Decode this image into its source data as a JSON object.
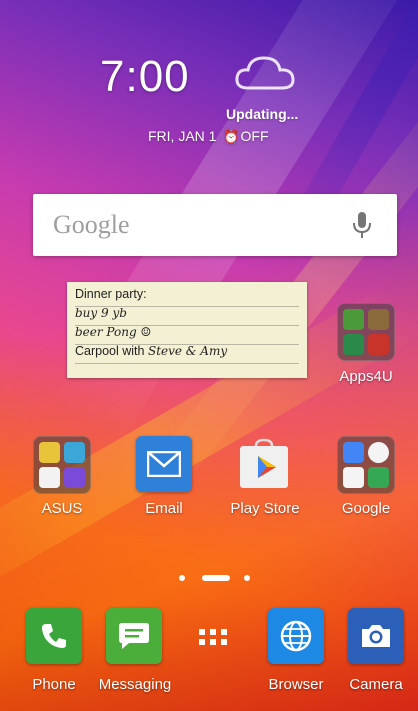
{
  "clock": {
    "time": "7:00"
  },
  "weather": {
    "status": "Updating...",
    "icon": "cloud-icon"
  },
  "date": {
    "text": "FRI, JAN 1",
    "alarm_status": "OFF",
    "alarm_icon": "alarm-clock-icon"
  },
  "search": {
    "logo": "Google",
    "mic_icon": "microphone-icon"
  },
  "memo": {
    "line1": "Dinner party:",
    "line2": "buy 9 yb",
    "line3": "beer Pong ☺",
    "line4_typed": "Carpool with",
    "line4_hand": "Steve & Amy"
  },
  "home": {
    "apps4u": {
      "label": "Apps4U"
    },
    "asus": {
      "label": "ASUS"
    },
    "email": {
      "label": "Email"
    },
    "play_store": {
      "label": "Play Store"
    },
    "google": {
      "label": "Google"
    }
  },
  "page_indicator": {
    "pages": 3,
    "active_page": 2
  },
  "dock": {
    "phone": {
      "label": "Phone"
    },
    "messaging": {
      "label": "Messaging"
    },
    "all_apps": {
      "icon": "app-drawer-icon"
    },
    "browser": {
      "label": "Browser"
    },
    "camera": {
      "label": "Camera"
    }
  },
  "colors": {
    "email": "#2f80d8",
    "phone": "#3aa53a",
    "messaging": "#4cae3a",
    "browser": "#1e88e5",
    "camera": "#2b5fb8"
  }
}
